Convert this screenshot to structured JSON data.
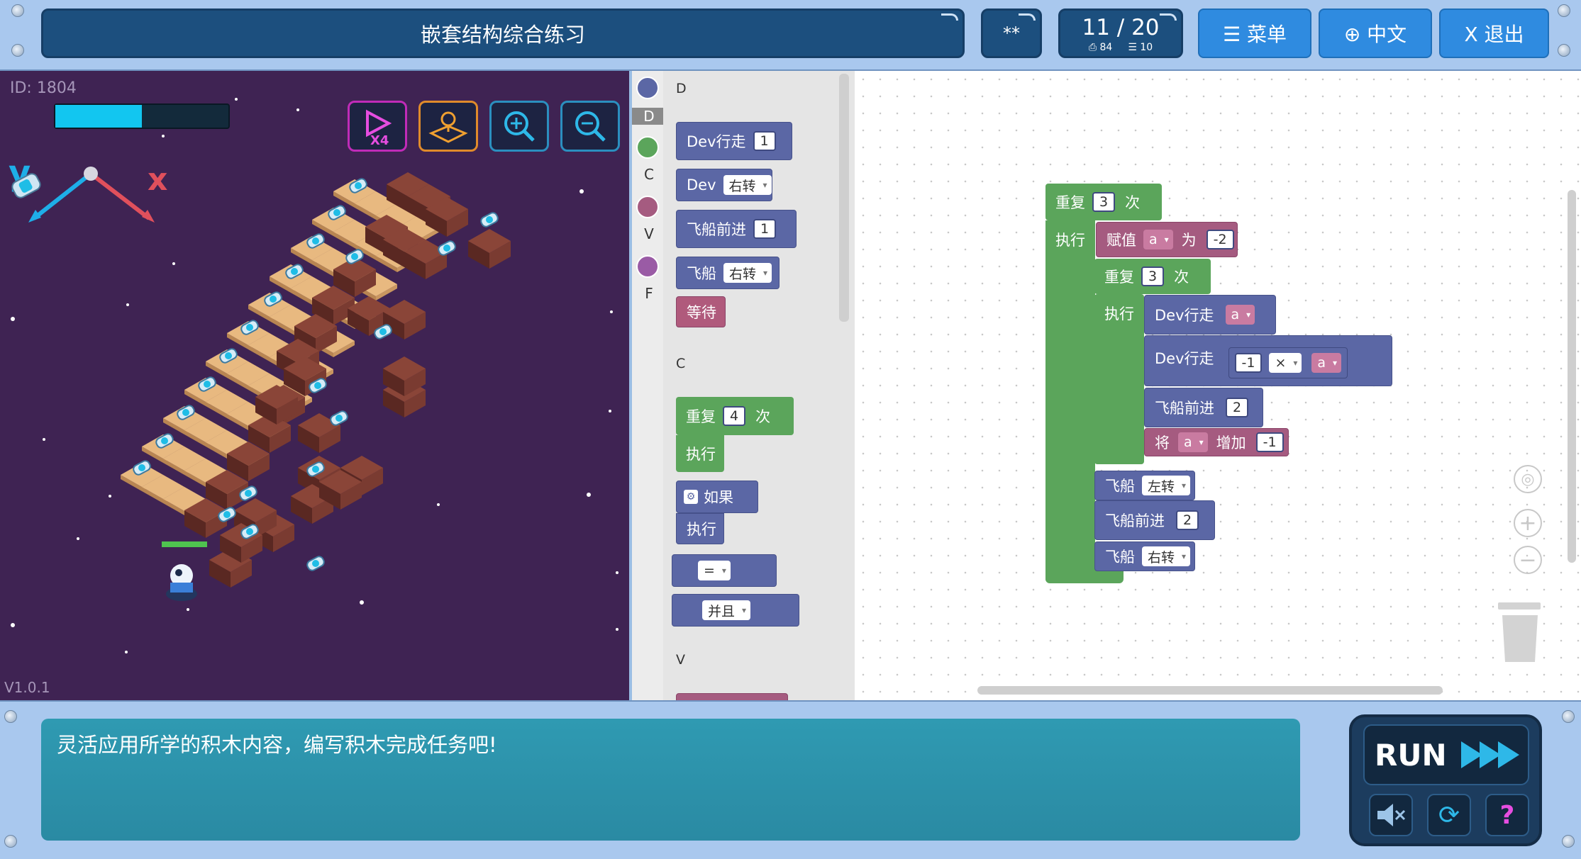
{
  "header": {
    "title": "嵌套结构综合练习",
    "password": "**",
    "level": "11 / 20",
    "stat_steps": "⎙ 84",
    "stat_blocks": "☰ 10",
    "menu_label": "☰ 菜单",
    "lang_label": "⊕ 中文",
    "exit_label": "X 退出"
  },
  "game": {
    "id_text": "ID: 1804",
    "version": "V1.0.1",
    "battery_level": 0.5,
    "axis_y": "y",
    "axis_x": "x",
    "buttons": [
      "speed-x4-icon",
      "map-icon",
      "zoom-in-icon",
      "zoom-out-icon"
    ]
  },
  "toolbox": {
    "categories": [
      {
        "label": "D",
        "color": "#5b67a5"
      },
      {
        "label": "C",
        "color": "#5ba55b"
      },
      {
        "label": "V",
        "color": "#a55b80"
      },
      {
        "label": "F",
        "color": "#9a5ba5"
      }
    ],
    "section_d": "D",
    "section_c": "C",
    "section_v": "V",
    "dev_walk": "Dev行走",
    "dev_walk_val": "1",
    "dev": "Dev",
    "turn_right": "右转",
    "ship_forward": "飞船前进",
    "ship_forward_val": "1",
    "ship": "飞船",
    "wait": "等待",
    "repeat": "重复",
    "repeat_val": "4",
    "times": "次",
    "do": "执行",
    "if": "如果",
    "eq": "=",
    "and": "并且"
  },
  "workspace": {
    "repeat": "重复",
    "outer_times_val": "3",
    "times": "次",
    "do": "执行",
    "assign": "赋值",
    "var_a": "a",
    "as": "为",
    "assign_val": "-2",
    "inner_times_val": "3",
    "dev_walk": "Dev行走",
    "neg_one": "-1",
    "mul": "×",
    "ship_forward": "飞船前进",
    "ship_forward_val": "2",
    "set": "将",
    "increase": "增加",
    "increase_val": "-1",
    "ship": "飞船",
    "turn_left": "左转",
    "turn_right": "右转",
    "ship_forward_val2": "2"
  },
  "footer": {
    "message": "灵活应用所学的积木内容，编写积木完成任务吧!",
    "run_label": "RUN"
  },
  "colors": {
    "accent": "#2f8be0",
    "panel": "#1c4f7e",
    "game_bg": "#3f2353",
    "tile_light": "#e8b980",
    "tile_dark": "#7a3b31"
  }
}
